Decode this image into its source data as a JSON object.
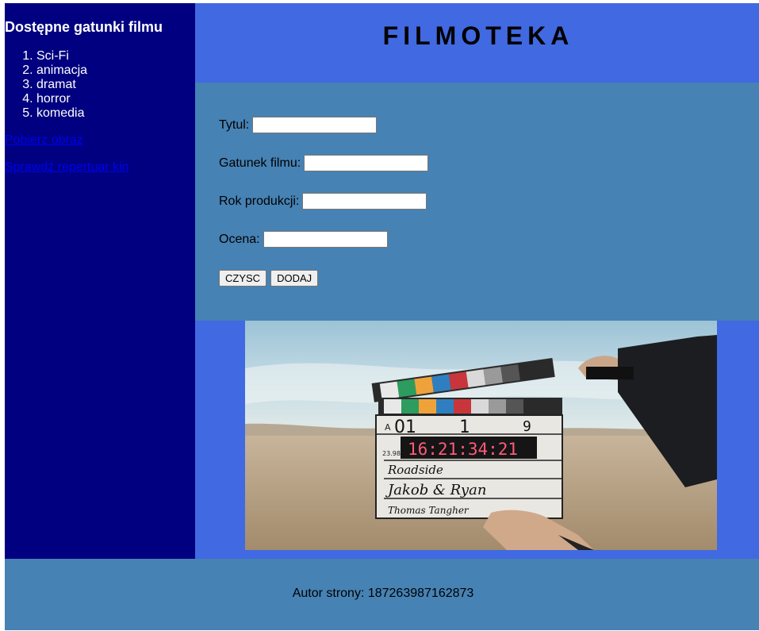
{
  "sidebar": {
    "heading": "Dostępne gatunki filmu",
    "genres": [
      "Sci-Fi",
      "animacja",
      "dramat",
      "horror",
      "komedia"
    ],
    "links": {
      "download_image": "Pobierz obraz",
      "cinema_repertoire": "Sprawdź repertuar kin"
    }
  },
  "header": {
    "title": "FILMOTEKA"
  },
  "form": {
    "fields": {
      "title_label": "Tytul:",
      "genre_label": "Gatunek filmu:",
      "year_label": "Rok produkcji:",
      "rating_label": "Ocena:"
    },
    "values": {
      "title": "",
      "genre": "",
      "year": "",
      "rating": ""
    },
    "buttons": {
      "clear": "CZYSC",
      "add": "DODAJ"
    }
  },
  "image": {
    "clapperboard": {
      "scene": "1",
      "take": "9",
      "fps": "23.98",
      "timecode": "16:21:34:21",
      "production": "Roadside",
      "director": "Jakob & Ryan",
      "camera": "Thomas Tangher"
    }
  },
  "footer": {
    "author": "Autor strony: 187263987162873"
  },
  "colors": {
    "sidebar_bg": "#000080",
    "header_bg": "#4169e1",
    "form_bg": "#4682b4",
    "footer_bg": "#4682b4",
    "link": "#0000ee"
  }
}
